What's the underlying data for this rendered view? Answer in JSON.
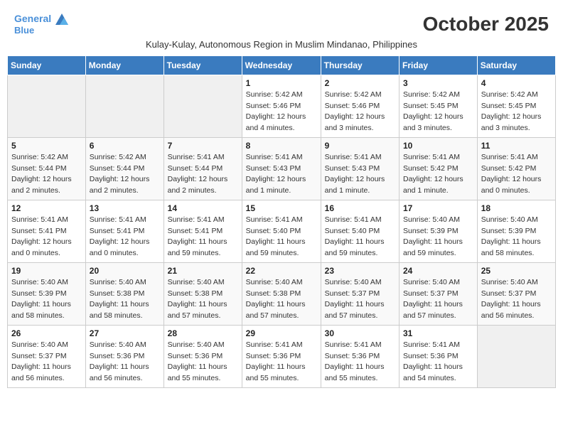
{
  "header": {
    "logo_line1": "General",
    "logo_line2": "Blue",
    "month_title": "October 2025",
    "subtitle": "Kulay-Kulay, Autonomous Region in Muslim Mindanao, Philippines"
  },
  "days_of_week": [
    "Sunday",
    "Monday",
    "Tuesday",
    "Wednesday",
    "Thursday",
    "Friday",
    "Saturday"
  ],
  "weeks": [
    [
      {
        "day": "",
        "info": ""
      },
      {
        "day": "",
        "info": ""
      },
      {
        "day": "",
        "info": ""
      },
      {
        "day": "1",
        "info": "Sunrise: 5:42 AM\nSunset: 5:46 PM\nDaylight: 12 hours\nand 4 minutes."
      },
      {
        "day": "2",
        "info": "Sunrise: 5:42 AM\nSunset: 5:46 PM\nDaylight: 12 hours\nand 3 minutes."
      },
      {
        "day": "3",
        "info": "Sunrise: 5:42 AM\nSunset: 5:45 PM\nDaylight: 12 hours\nand 3 minutes."
      },
      {
        "day": "4",
        "info": "Sunrise: 5:42 AM\nSunset: 5:45 PM\nDaylight: 12 hours\nand 3 minutes."
      }
    ],
    [
      {
        "day": "5",
        "info": "Sunrise: 5:42 AM\nSunset: 5:44 PM\nDaylight: 12 hours\nand 2 minutes."
      },
      {
        "day": "6",
        "info": "Sunrise: 5:42 AM\nSunset: 5:44 PM\nDaylight: 12 hours\nand 2 minutes."
      },
      {
        "day": "7",
        "info": "Sunrise: 5:41 AM\nSunset: 5:44 PM\nDaylight: 12 hours\nand 2 minutes."
      },
      {
        "day": "8",
        "info": "Sunrise: 5:41 AM\nSunset: 5:43 PM\nDaylight: 12 hours\nand 1 minute."
      },
      {
        "day": "9",
        "info": "Sunrise: 5:41 AM\nSunset: 5:43 PM\nDaylight: 12 hours\nand 1 minute."
      },
      {
        "day": "10",
        "info": "Sunrise: 5:41 AM\nSunset: 5:42 PM\nDaylight: 12 hours\nand 1 minute."
      },
      {
        "day": "11",
        "info": "Sunrise: 5:41 AM\nSunset: 5:42 PM\nDaylight: 12 hours\nand 0 minutes."
      }
    ],
    [
      {
        "day": "12",
        "info": "Sunrise: 5:41 AM\nSunset: 5:41 PM\nDaylight: 12 hours\nand 0 minutes."
      },
      {
        "day": "13",
        "info": "Sunrise: 5:41 AM\nSunset: 5:41 PM\nDaylight: 12 hours\nand 0 minutes."
      },
      {
        "day": "14",
        "info": "Sunrise: 5:41 AM\nSunset: 5:41 PM\nDaylight: 11 hours\nand 59 minutes."
      },
      {
        "day": "15",
        "info": "Sunrise: 5:41 AM\nSunset: 5:40 PM\nDaylight: 11 hours\nand 59 minutes."
      },
      {
        "day": "16",
        "info": "Sunrise: 5:41 AM\nSunset: 5:40 PM\nDaylight: 11 hours\nand 59 minutes."
      },
      {
        "day": "17",
        "info": "Sunrise: 5:40 AM\nSunset: 5:39 PM\nDaylight: 11 hours\nand 59 minutes."
      },
      {
        "day": "18",
        "info": "Sunrise: 5:40 AM\nSunset: 5:39 PM\nDaylight: 11 hours\nand 58 minutes."
      }
    ],
    [
      {
        "day": "19",
        "info": "Sunrise: 5:40 AM\nSunset: 5:39 PM\nDaylight: 11 hours\nand 58 minutes."
      },
      {
        "day": "20",
        "info": "Sunrise: 5:40 AM\nSunset: 5:38 PM\nDaylight: 11 hours\nand 58 minutes."
      },
      {
        "day": "21",
        "info": "Sunrise: 5:40 AM\nSunset: 5:38 PM\nDaylight: 11 hours\nand 57 minutes."
      },
      {
        "day": "22",
        "info": "Sunrise: 5:40 AM\nSunset: 5:38 PM\nDaylight: 11 hours\nand 57 minutes."
      },
      {
        "day": "23",
        "info": "Sunrise: 5:40 AM\nSunset: 5:37 PM\nDaylight: 11 hours\nand 57 minutes."
      },
      {
        "day": "24",
        "info": "Sunrise: 5:40 AM\nSunset: 5:37 PM\nDaylight: 11 hours\nand 57 minutes."
      },
      {
        "day": "25",
        "info": "Sunrise: 5:40 AM\nSunset: 5:37 PM\nDaylight: 11 hours\nand 56 minutes."
      }
    ],
    [
      {
        "day": "26",
        "info": "Sunrise: 5:40 AM\nSunset: 5:37 PM\nDaylight: 11 hours\nand 56 minutes."
      },
      {
        "day": "27",
        "info": "Sunrise: 5:40 AM\nSunset: 5:36 PM\nDaylight: 11 hours\nand 56 minutes."
      },
      {
        "day": "28",
        "info": "Sunrise: 5:40 AM\nSunset: 5:36 PM\nDaylight: 11 hours\nand 55 minutes."
      },
      {
        "day": "29",
        "info": "Sunrise: 5:41 AM\nSunset: 5:36 PM\nDaylight: 11 hours\nand 55 minutes."
      },
      {
        "day": "30",
        "info": "Sunrise: 5:41 AM\nSunset: 5:36 PM\nDaylight: 11 hours\nand 55 minutes."
      },
      {
        "day": "31",
        "info": "Sunrise: 5:41 AM\nSunset: 5:36 PM\nDaylight: 11 hours\nand 54 minutes."
      },
      {
        "day": "",
        "info": ""
      }
    ]
  ]
}
